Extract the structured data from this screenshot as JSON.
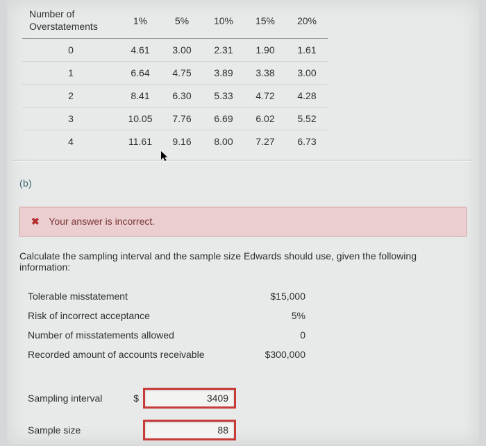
{
  "chart_data": {
    "type": "table",
    "row_header": "Number of Overstatements",
    "columns": [
      "1%",
      "5%",
      "10%",
      "15%",
      "20%"
    ],
    "rows": [
      {
        "n": "0",
        "v": [
          "4.61",
          "3.00",
          "2.31",
          "1.90",
          "1.61"
        ]
      },
      {
        "n": "1",
        "v": [
          "6.64",
          "4.75",
          "3.89",
          "3.38",
          "3.00"
        ]
      },
      {
        "n": "2",
        "v": [
          "8.41",
          "6.30",
          "5.33",
          "4.72",
          "4.28"
        ]
      },
      {
        "n": "3",
        "v": [
          "10.05",
          "7.76",
          "6.69",
          "6.02",
          "5.52"
        ]
      },
      {
        "n": "4",
        "v": [
          "11.61",
          "9.16",
          "8.00",
          "7.27",
          "6.73"
        ]
      }
    ]
  },
  "part_label": "(b)",
  "alert": {
    "icon_text": "✖",
    "text": "Your answer is incorrect."
  },
  "prompt": "Calculate the sampling interval and the sample size Edwards should use, given the following information:",
  "info": [
    {
      "label": "Tolerable misstatement",
      "value": "$15,000"
    },
    {
      "label": "Risk of incorrect acceptance",
      "value": "5%"
    },
    {
      "label": "Number of misstatements allowed",
      "value": "0"
    },
    {
      "label": "Recorded amount of accounts receivable",
      "value": "$300,000"
    }
  ],
  "answers": {
    "sampling_interval_label": "Sampling interval",
    "sampling_interval_currency": "$",
    "sampling_interval_value": "3409",
    "sample_size_label": "Sample size",
    "sample_size_value": "88"
  }
}
